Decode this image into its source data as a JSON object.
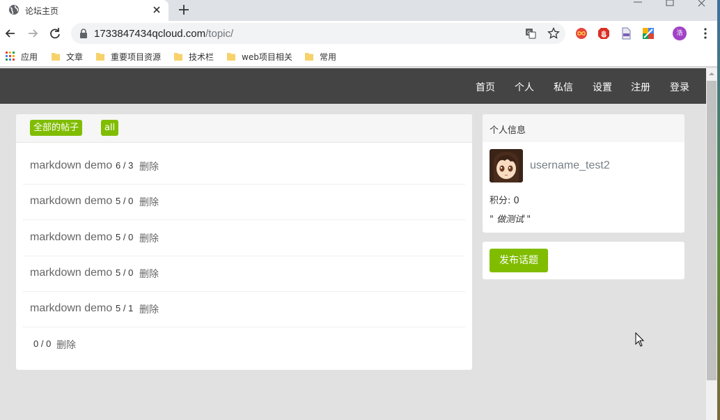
{
  "browser": {
    "tab_title": "论坛主页",
    "url_host": "1733847434qcloud.com",
    "url_path": "/topic/",
    "bookmarks": [
      {
        "label": "应用",
        "icon": "apps-grid-icon"
      },
      {
        "label": "文章",
        "icon": "folder-icon"
      },
      {
        "label": "重要项目资源",
        "icon": "folder-icon"
      },
      {
        "label": "技术栏",
        "icon": "folder-icon"
      },
      {
        "label": "web项目相关",
        "icon": "folder-icon"
      },
      {
        "label": "常用",
        "icon": "folder-icon"
      }
    ],
    "profile_initial": "浩"
  },
  "navbar": {
    "items": [
      "首页",
      "个人",
      "私信",
      "设置",
      "注册",
      "登录"
    ]
  },
  "topics_panel": {
    "tag_all_posts": "全部的帖子",
    "tag_all": "all",
    "rows": [
      {
        "title": "markdown demo",
        "count": "6 / 3",
        "delete": "删除"
      },
      {
        "title": "markdown demo",
        "count": "5 / 0",
        "delete": "删除"
      },
      {
        "title": "markdown demo",
        "count": "5 / 0",
        "delete": "删除"
      },
      {
        "title": "markdown demo",
        "count": "5 / 0",
        "delete": "删除"
      },
      {
        "title": "markdown demo",
        "count": "5 / 1",
        "delete": "删除"
      },
      {
        "title": "",
        "count": "0 / 0",
        "delete": "删除"
      }
    ]
  },
  "profile_panel": {
    "title": "个人信息",
    "username": "username_test2",
    "score": "积分: 0",
    "signature": "\" 做测试 \""
  },
  "post_panel": {
    "button": "发布话题"
  },
  "colors": {
    "accent": "#80bd01",
    "navbar": "#444444"
  }
}
